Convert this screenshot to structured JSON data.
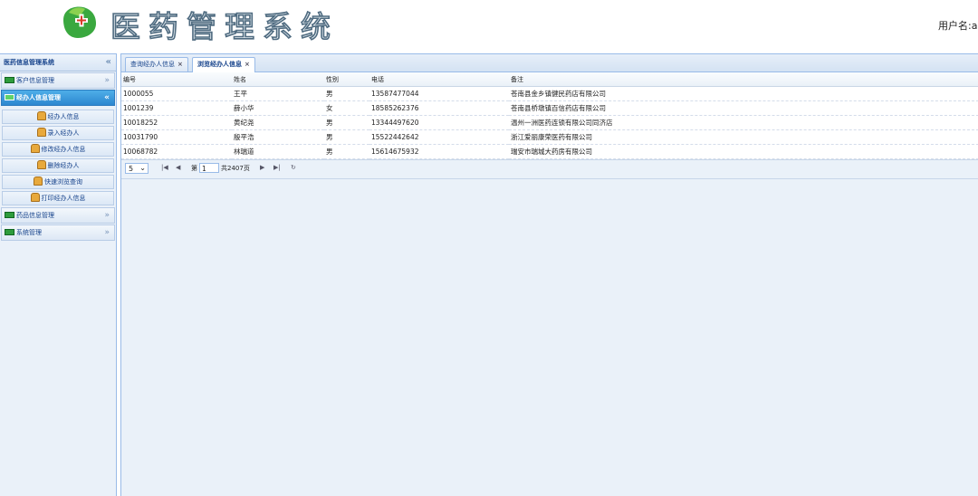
{
  "header": {
    "app_title": "医药管理系统",
    "user_label": "用户名:ac"
  },
  "sidebar": {
    "title": "医药信息管理系统",
    "collapse_glyph": "«",
    "sections": [
      {
        "label": "客户信息管理",
        "expanded": false
      },
      {
        "label": "经办人信息管理",
        "expanded": true,
        "items": [
          {
            "label": "经办人信息"
          },
          {
            "label": "录入经办人"
          },
          {
            "label": "修改经办人信息"
          },
          {
            "label": "删除经办人"
          },
          {
            "label": "快速浏览查询"
          },
          {
            "label": "打印经办人信息"
          }
        ]
      },
      {
        "label": "药品信息管理",
        "expanded": false
      },
      {
        "label": "系统管理",
        "expanded": false
      }
    ]
  },
  "tabs": [
    {
      "label": "查询经办人信息",
      "close": "×",
      "active": false
    },
    {
      "label": "浏览经办人信息",
      "close": "×",
      "active": true
    }
  ],
  "grid": {
    "columns": [
      "编号",
      "姓名",
      "性别",
      "电话",
      "备注"
    ],
    "rows": [
      [
        "1000055",
        "王平",
        "男",
        "13587477044",
        "苍南县金乡镇健民药店有限公司"
      ],
      [
        "1001239",
        "薛小华",
        "女",
        "18585262376",
        "苍南县桥墩镇百信药店有限公司"
      ],
      [
        "10018252",
        "黄纪尧",
        "男",
        "13344497620",
        "温州一洲医药连锁有限公司同济店"
      ],
      [
        "10031790",
        "殷平浩",
        "男",
        "15522442642",
        "浙江爱丽康荣医药有限公司"
      ],
      [
        "10068782",
        "林瑞道",
        "男",
        "15614675932",
        "瑞安市瑞城大药房有限公司"
      ]
    ]
  },
  "pager": {
    "page_size": "5",
    "page_prefix": "第",
    "page_number": "1",
    "total_pages": "共2407页",
    "first_glyph": "|◀",
    "prev_glyph": "◀",
    "next_glyph": "▶",
    "last_glyph": "▶|",
    "refresh_glyph": "↻"
  },
  "colors": {
    "active_accent": "#2d87d0",
    "panel_border": "#99bbe8",
    "logo_green": "#3aa83f",
    "logo_red": "#d93a2b"
  }
}
